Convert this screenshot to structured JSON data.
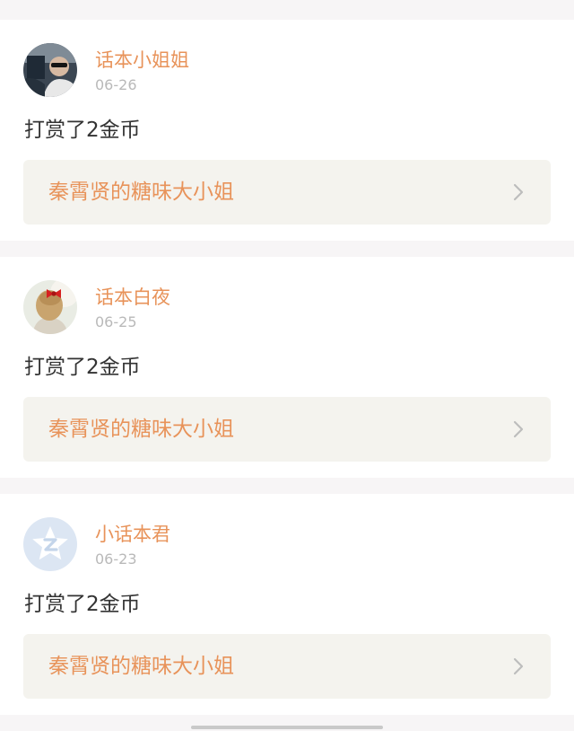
{
  "feed": {
    "items": [
      {
        "user": "话本小姐姐",
        "date": "06-26",
        "action": "打赏了2金币",
        "story": "秦霄贤的糖味大小姐",
        "avatar_icon": "photo-avatar-car-driver"
      },
      {
        "user": "话本白夜",
        "date": "06-25",
        "action": "打赏了2金币",
        "story": "秦霄贤的糖味大小姐",
        "avatar_icon": "photo-avatar-girl-red-bow"
      },
      {
        "user": "小话本君",
        "date": "06-23",
        "action": "打赏了2金币",
        "story": "秦霄贤的糖味大小姐",
        "avatar_icon": "qq-default-avatar"
      }
    ]
  },
  "colors": {
    "username": "#e8935a",
    "story_title": "#e8935a",
    "date": "#b9b9b9",
    "action_text": "#333333",
    "story_bg": "#f4f3ee",
    "page_bg": "#f7f5f6",
    "card_bg": "#ffffff"
  }
}
